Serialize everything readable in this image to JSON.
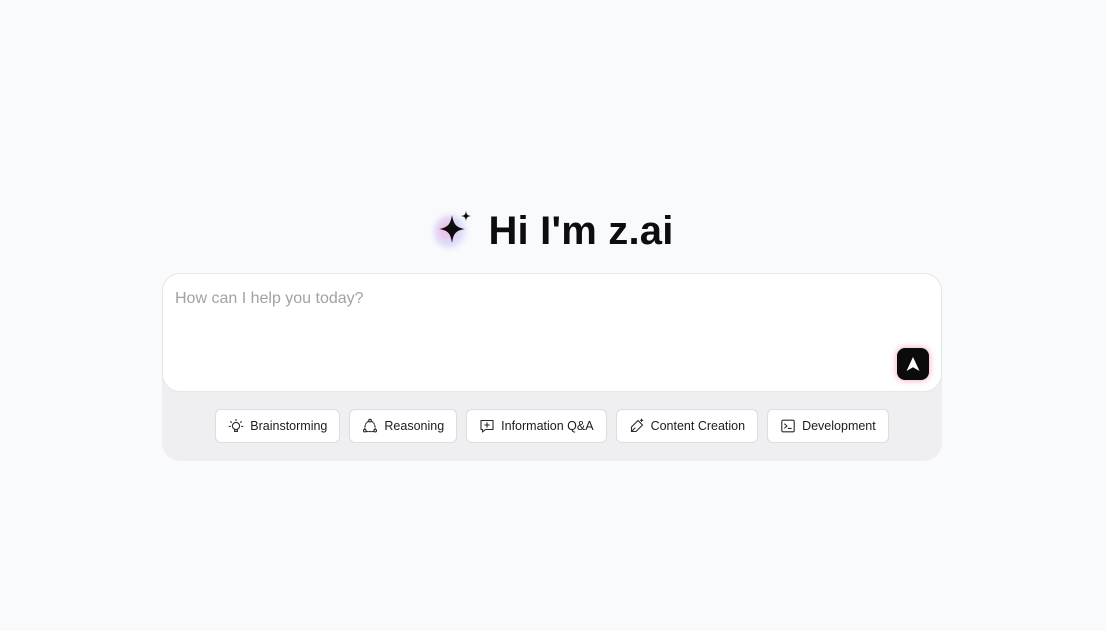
{
  "hero": {
    "title": "Hi I'm z.ai",
    "logo_icon": "sparkle-icon"
  },
  "composer": {
    "placeholder": "How can I help you today?",
    "value": "",
    "send_icon": "send-arrow-icon"
  },
  "suggestions": [
    {
      "label": "Brainstorming",
      "icon": "lightbulb-icon"
    },
    {
      "label": "Reasoning",
      "icon": "reasoning-cycle-icon"
    },
    {
      "label": "Information Q&A",
      "icon": "chat-plus-icon"
    },
    {
      "label": "Content Creation",
      "icon": "pen-spark-icon"
    },
    {
      "label": "Development",
      "icon": "terminal-icon"
    }
  ],
  "colors": {
    "background": "#f9fafc",
    "composer_tray": "#efeff1",
    "send_button": "#0b0b0c",
    "glow_accent": "#f6aad6"
  }
}
